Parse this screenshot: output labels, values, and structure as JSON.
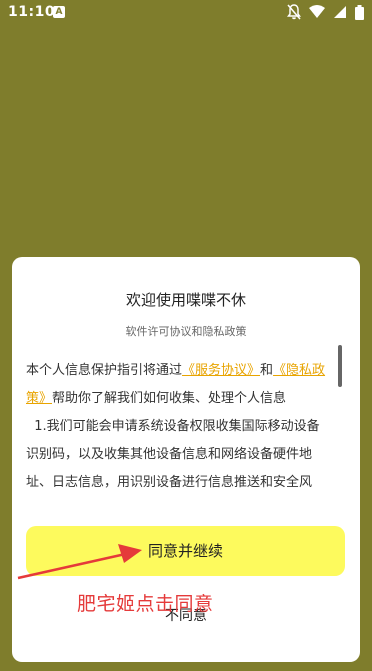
{
  "status_bar": {
    "time": "11:10",
    "notification_glyph": "A",
    "icons": [
      "notifications-off-icon",
      "wifi-icon",
      "signal-icon",
      "battery-icon"
    ]
  },
  "dialog": {
    "title": "欢迎使用喋喋不休",
    "subtitle": "软件许可协议和隐私政策",
    "body": {
      "intro_prefix": "本个人信息保护指引将通过",
      "link_service": "《服务协议》",
      "and": "和",
      "link_privacy": "《隐私政策》",
      "intro_suffix": "帮助你了解我们如何收集、处理个人信息",
      "item_1": "1.我们可能会申请系统设备权限收集国际移动设备识别码，以及收集其他设备信息和网络设备硬件地址、日志信息，用识别设备进行信息推送和安全风"
    },
    "agree_label": "同意并继续",
    "disagree_label": "不同意"
  },
  "annotation": {
    "text": "肥宅姬点击同意",
    "color": "#e53a3a"
  },
  "colors": {
    "background": "#7f7d2c",
    "agree_button": "#fdfa5d",
    "link": "#e8a400"
  }
}
